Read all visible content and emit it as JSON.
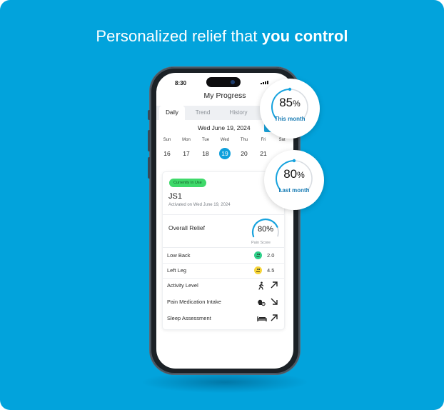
{
  "headline": {
    "regular": "Personalized relief that ",
    "bold": "you control"
  },
  "phone": {
    "status_bar": {
      "time": "8:30"
    },
    "screen_title": "My Progress",
    "tabs": [
      {
        "label": "Daily",
        "active": true
      },
      {
        "label": "Trend",
        "active": false
      },
      {
        "label": "History",
        "active": false
      }
    ],
    "date": {
      "label": "Wed June 19, 2024",
      "today_button": "To"
    },
    "week": [
      {
        "dow": "Sun",
        "date": "16"
      },
      {
        "dow": "Mon",
        "date": "17"
      },
      {
        "dow": "Tue",
        "date": "18"
      },
      {
        "dow": "Wed",
        "date": "19",
        "selected": true
      },
      {
        "dow": "Thu",
        "date": "20"
      },
      {
        "dow": "Fri",
        "date": "21"
      },
      {
        "dow": "Sat",
        "date": ""
      }
    ],
    "device_card": {
      "badge": "Currently In Use",
      "name": "JS1",
      "activated": "Activated on Wed June 19, 2024",
      "overall_relief": {
        "label": "Overall Relief",
        "value": "80%",
        "fraction": 0.8,
        "caption": "Pain Score"
      },
      "pain_rows": [
        {
          "label": "Low Back",
          "face": "happy",
          "color": "#2fd08a",
          "value": "2.0"
        },
        {
          "label": "Left Leg",
          "face": "neutral",
          "color": "#f7d53a",
          "value": "4.5"
        }
      ],
      "metric_rows": [
        {
          "label": "Activity Level",
          "icon": "walking-icon",
          "glyph": "🚶",
          "trend": "up",
          "arrow": "↗"
        },
        {
          "label": "Pain Medication Intake",
          "icon": "pill-icon",
          "glyph": "💊",
          "trend": "down",
          "arrow": "↘"
        },
        {
          "label": "Sleep Assessment",
          "icon": "bed-icon",
          "glyph": "🛏",
          "trend": "up",
          "arrow": "↗"
        }
      ]
    }
  },
  "bubbles": [
    {
      "value": "85",
      "unit": "%",
      "fraction": 0.85,
      "caption": "This month"
    },
    {
      "value": "80",
      "unit": "%",
      "fraction": 0.8,
      "caption": "Last month"
    }
  ],
  "colors": {
    "background": "#02a3dc",
    "accent": "#0fa0dc",
    "badge": "#3fd96a",
    "caption": "#1a7cb4"
  }
}
